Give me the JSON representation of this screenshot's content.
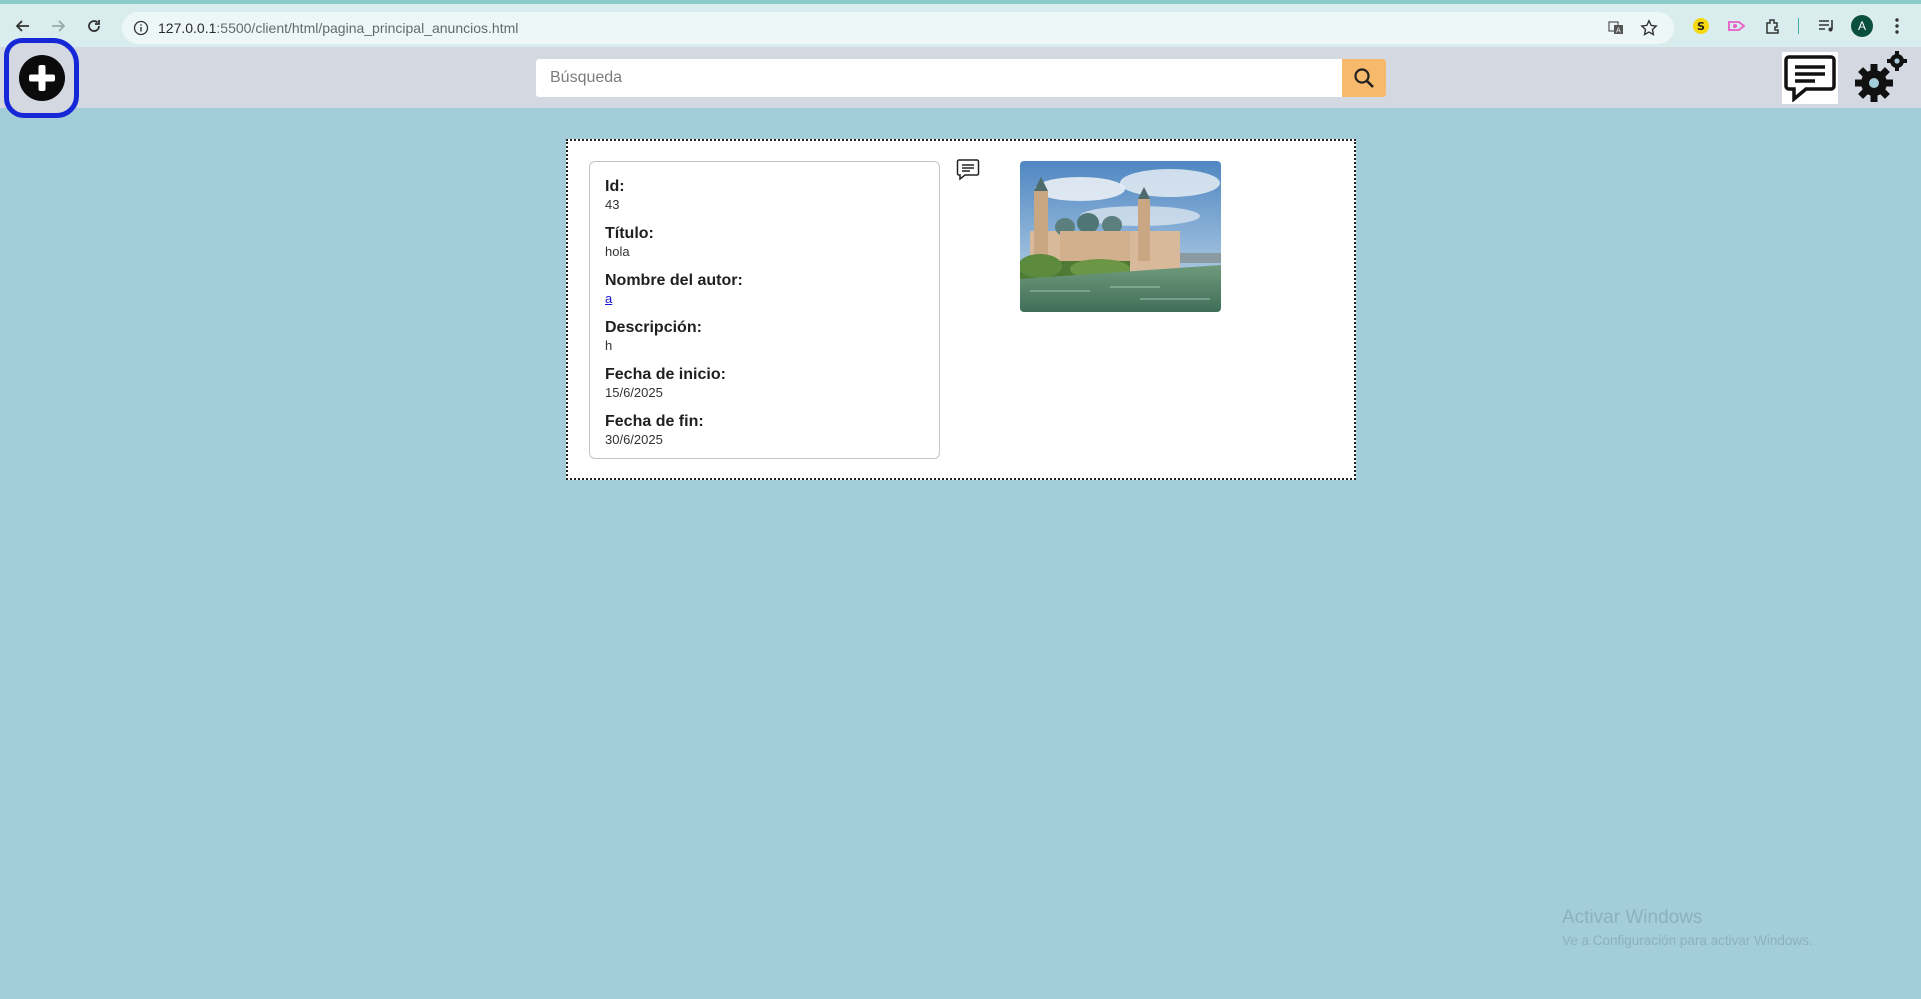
{
  "browser": {
    "url_host": "127.0.0.1",
    "url_path": ":5500/client/html/pagina_principal_anuncios.html",
    "profile_initial": "A"
  },
  "header": {
    "search_placeholder": "Búsqueda"
  },
  "ad": {
    "fields": [
      {
        "label": "Id:",
        "value": "43"
      },
      {
        "label": "Título:",
        "value": "hola"
      },
      {
        "label": "Nombre del autor:",
        "value": "a"
      },
      {
        "label": "Descripción:",
        "value": "h"
      },
      {
        "label": "Fecha de inicio:",
        "value": "15/6/2025"
      },
      {
        "label": "Fecha de fin:",
        "value": "30/6/2025"
      }
    ]
  },
  "watermark": {
    "title": "Activar Windows",
    "subtitle": "Ve a Configuración para activar Windows."
  },
  "colors": {
    "page_bg": "#a3cdd9",
    "header_bg": "#d4d9e1",
    "search_button": "#f7b96c",
    "add_button_outline": "#1527d6"
  },
  "icons": [
    "back-icon",
    "forward-icon",
    "reload-icon",
    "site-info-icon",
    "translate-icon",
    "star-icon",
    "extension-icon",
    "media-icon",
    "menu-icon",
    "add-circle-icon",
    "search-icon",
    "chat-icon",
    "settings-icon",
    "comment-icon"
  ]
}
